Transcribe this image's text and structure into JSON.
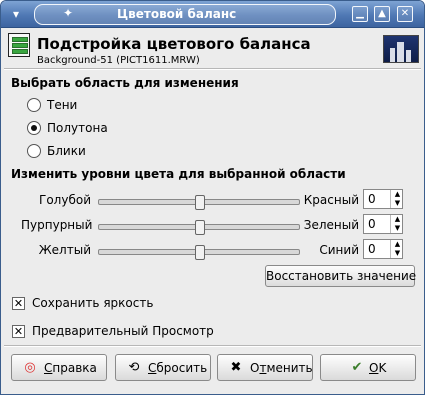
{
  "window": {
    "title": "Цветовой баланс",
    "menu_icon": "window-menu-icon",
    "minimize_icon": "minimize-icon",
    "maximize_icon": "maximize-icon",
    "close_icon": "close-icon"
  },
  "header": {
    "title": "Подстройка цветового баланса",
    "subtitle": "Background-51 (PICT1611.MRW)"
  },
  "range": {
    "heading": "Выбрать область для изменения",
    "options": [
      {
        "label": "Тени",
        "selected": false
      },
      {
        "label": "Полутона",
        "selected": true
      },
      {
        "label": "Блики",
        "selected": false
      }
    ]
  },
  "levels": {
    "heading": "Изменить уровни цвета для выбранной области",
    "rows": [
      {
        "left": "Голубой",
        "right": "Красный",
        "value": "0"
      },
      {
        "left": "Пурпурный",
        "right": "Зеленый",
        "value": "0"
      },
      {
        "left": "Желтый",
        "right": "Синий",
        "value": "0"
      }
    ],
    "restore_label": "Восстановить значение"
  },
  "options": {
    "preserve_luminosity": {
      "label": "Сохранить яркость",
      "checked": true
    },
    "preview": {
      "label": "Предварительный Просмотр",
      "checked": true
    }
  },
  "buttons": {
    "help": {
      "first": "С",
      "rest": "правка",
      "icon": "help-lifebuoy-icon"
    },
    "reset": {
      "first": "С",
      "rest": "бросить",
      "icon": "reset-icon"
    },
    "cancel": {
      "prefix": "О",
      "first": "т",
      "rest": "менить",
      "icon": "cancel-x-icon"
    },
    "ok": {
      "first": "О",
      "rest": "K",
      "icon": "ok-check-icon"
    }
  }
}
